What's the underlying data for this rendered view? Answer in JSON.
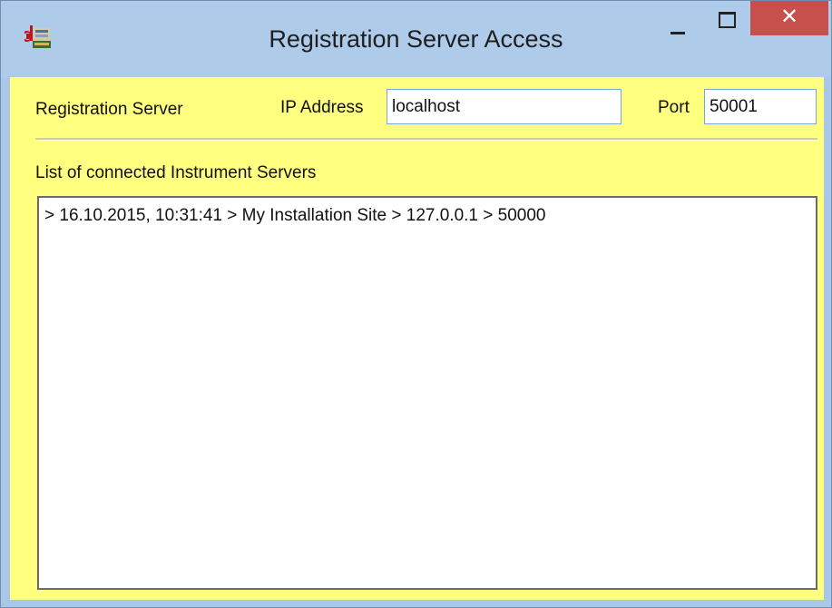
{
  "window": {
    "title": "Registration Server Access",
    "close_glyph": "✕",
    "icon": "app-logo-icon"
  },
  "form": {
    "server_label": "Registration Server",
    "ip_label": "IP Address",
    "ip_value": "localhost",
    "port_label": "Port",
    "port_value": "50001"
  },
  "list": {
    "label": "List of connected Instrument Servers",
    "items": [
      "> 16.10.2015, 10:31:41 > My Installation Site > 127.0.0.1 > 50000"
    ]
  },
  "colors": {
    "titlebar": "#aecbea",
    "client_background": "#ffff80",
    "close_button": "#c7504d"
  }
}
